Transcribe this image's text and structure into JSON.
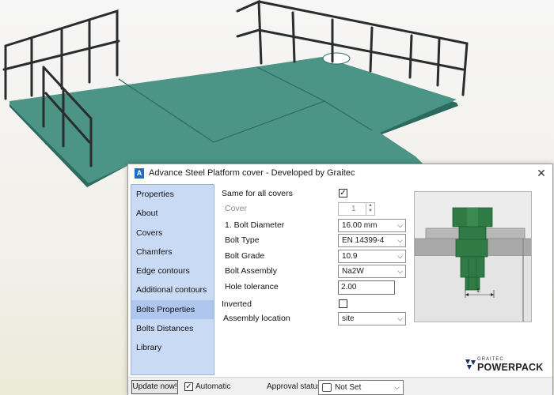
{
  "dialog": {
    "title": "Advance Steel  Platform cover - Developed by Graitec",
    "app_logo_letter": "A",
    "close_glyph": "✕"
  },
  "sidebar": {
    "items": [
      {
        "label": "Properties",
        "active": false
      },
      {
        "label": "About",
        "active": false
      },
      {
        "label": "Covers",
        "active": false
      },
      {
        "label": "Chamfers",
        "active": false
      },
      {
        "label": "Edge contours",
        "active": false
      },
      {
        "label": "Additional contours",
        "active": false
      },
      {
        "label": "Bolts Properties",
        "active": true
      },
      {
        "label": "Bolts Distances",
        "active": false
      },
      {
        "label": "Library",
        "active": false
      }
    ]
  },
  "form": {
    "same_for_all": {
      "label": "Same for all covers",
      "checked": true
    },
    "cover": {
      "label": "Cover",
      "value": "1"
    },
    "bolt_diameter": {
      "label": "1. Bolt Diameter",
      "value": "16.00 mm"
    },
    "bolt_type": {
      "label": "Bolt Type",
      "value": "EN 14399-4"
    },
    "bolt_grade": {
      "label": "Bolt Grade",
      "value": "10.9"
    },
    "bolt_assembly": {
      "label": "Bolt Assembly",
      "value": "Na2W"
    },
    "hole_tolerance": {
      "label": "Hole tolerance",
      "value": "2.00"
    },
    "inverted": {
      "label": "Inverted",
      "checked": false
    },
    "assembly_location": {
      "label": "Assembly location",
      "value": "site"
    }
  },
  "preview": {
    "dimension_label": "1."
  },
  "brand": {
    "small": "GRAITEC",
    "big": "POWERPACK"
  },
  "bottom": {
    "update_label": "Update now!",
    "automatic": {
      "label": "Automatic",
      "checked": true
    },
    "approval_label": "Approval status",
    "approval_value": "Not Set"
  },
  "icons": {
    "checkbox_checked": "✓",
    "dropdown": "⌵",
    "spin_up": "▲",
    "spin_down": "▼"
  },
  "colors": {
    "plate": "#4a9285",
    "plate_dark": "#2f6e63",
    "railing": "#2a2d2d",
    "sidebar": "#c9daf5",
    "sidebar_active": "#afc7ee",
    "bolt_green": "#2f7a45"
  }
}
